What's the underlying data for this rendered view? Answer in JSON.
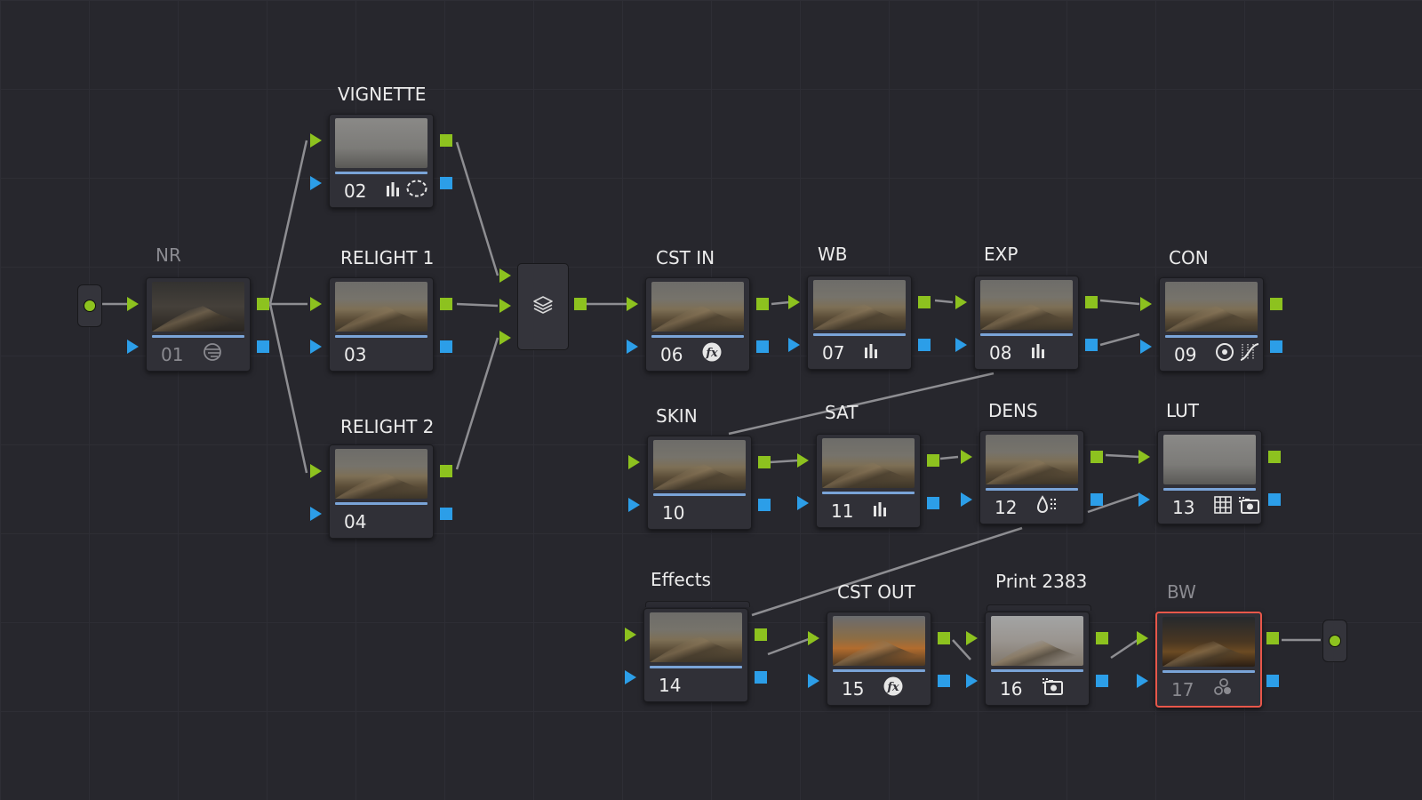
{
  "node_editor": {
    "input_terminal": {
      "name": "source-input"
    },
    "output_terminal": {
      "name": "clip-output"
    },
    "layer_mixer": {
      "icon": "layers-icon"
    },
    "nodes": [
      {
        "id": "n01",
        "label": "NR",
        "number": "01",
        "icons": [
          "noise-reduction-icon"
        ],
        "dim": true
      },
      {
        "id": "n02",
        "label": "VIGNETTE",
        "number": "02",
        "icons": [
          "levels-icon",
          "window-icon"
        ]
      },
      {
        "id": "n03",
        "label": "RELIGHT 1",
        "number": "03",
        "icons": []
      },
      {
        "id": "n04",
        "label": "RELIGHT 2",
        "number": "04",
        "icons": []
      },
      {
        "id": "n06",
        "label": "CST IN",
        "number": "06",
        "icons": [
          "fx-icon"
        ]
      },
      {
        "id": "n07",
        "label": "WB",
        "number": "07",
        "icons": [
          "levels-icon"
        ]
      },
      {
        "id": "n08",
        "label": "EXP",
        "number": "08",
        "icons": [
          "levels-icon"
        ]
      },
      {
        "id": "n09",
        "label": "CON",
        "number": "09",
        "icons": [
          "pivot-icon",
          "curves-icon"
        ]
      },
      {
        "id": "n10",
        "label": "SKIN",
        "number": "10",
        "icons": []
      },
      {
        "id": "n11",
        "label": "SAT",
        "number": "11",
        "icons": [
          "levels-icon"
        ]
      },
      {
        "id": "n12",
        "label": "DENS",
        "number": "12",
        "icons": [
          "density-icon"
        ]
      },
      {
        "id": "n13",
        "label": "LUT",
        "number": "13",
        "icons": [
          "lut-grid-icon",
          "key-camera-icon"
        ]
      },
      {
        "id": "n14",
        "label": "Effects",
        "number": "14",
        "icons": []
      },
      {
        "id": "n15",
        "label": "CST OUT",
        "number": "15",
        "icons": [
          "fx-icon"
        ]
      },
      {
        "id": "n16",
        "label": "Print 2383",
        "number": "16",
        "icons": [
          "key-camera-icon"
        ]
      },
      {
        "id": "n17",
        "label": "BW",
        "number": "17",
        "icons": [
          "rgb-mixer-icon"
        ],
        "dim": true,
        "selected": true
      }
    ]
  },
  "colors": {
    "background": "#27272d",
    "rgb_port": "#8dc21f",
    "key_port": "#2c9ee8",
    "wire": "#8e8e92",
    "selected_outline": "#e8574a"
  }
}
